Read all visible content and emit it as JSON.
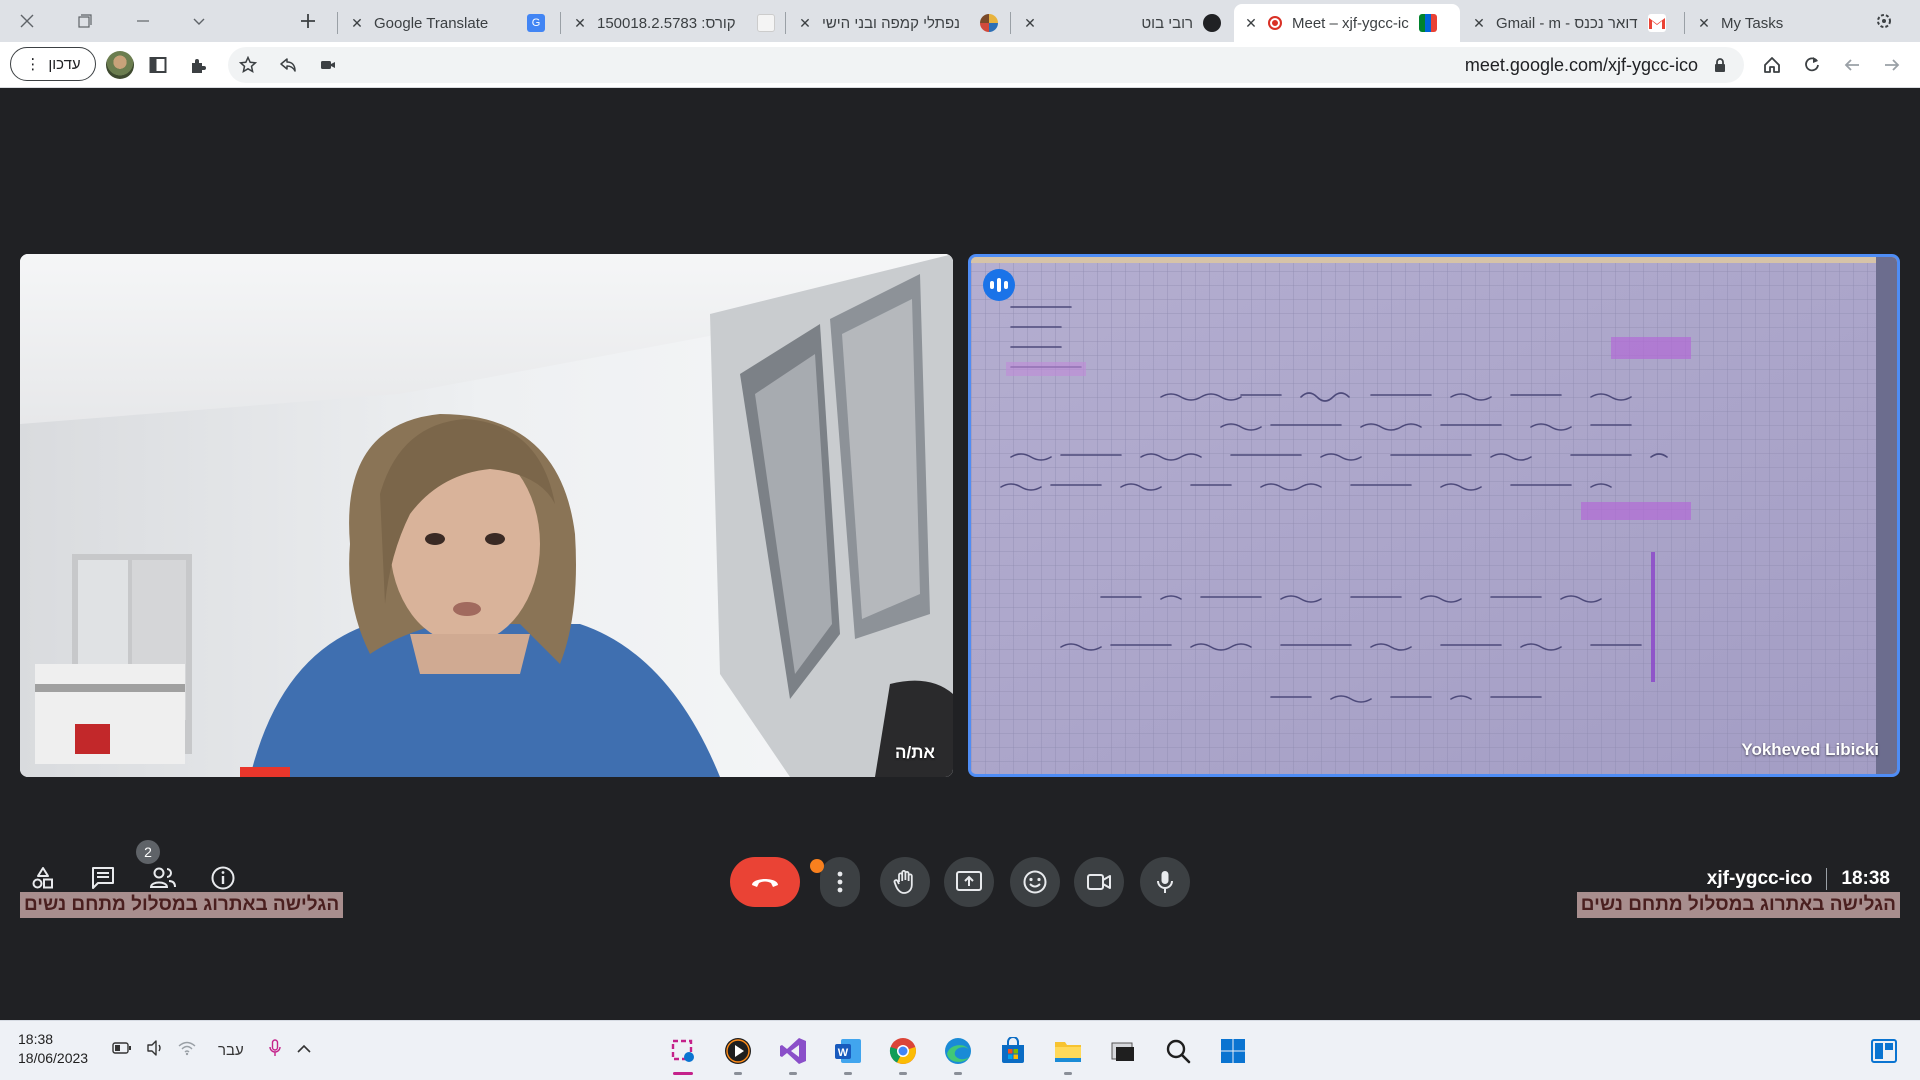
{
  "tabs": [
    {
      "title": "My Tasks",
      "favicon": "tasks-icon"
    },
    {
      "title": "דואר נכנס - Gmail - m",
      "favicon": "gmail-icon"
    },
    {
      "title": "Meet – xjf-ygcc-ic",
      "favicon": "meet-icon",
      "recording": true,
      "active": true
    },
    {
      "title": "רובי בוט",
      "favicon": "bot-icon"
    },
    {
      "title": "נפתלי קמפה ובני הישי",
      "favicon": "globe-icon"
    },
    {
      "title": "קורס: 150018.2.5783",
      "favicon": "moodle-icon"
    },
    {
      "title": "Google Translate",
      "favicon": "translate-icon"
    }
  ],
  "toolbar": {
    "url": "meet.google.com/xjf-ygcc-ico",
    "update_label": "עדכון"
  },
  "meet": {
    "self_tile_label": "את/ה",
    "remote_tile_label": "Yokheved Libicki",
    "participant_count": "2",
    "meeting_code": "xjf-ygcc-ico",
    "time": "18:38",
    "caption_text": "הגלישה באתרוג במסלול מתחם נשים",
    "end_color": "#ea4335",
    "speaking_color": "#1a73e8"
  },
  "taskbar": {
    "time": "18:38",
    "date": "18/06/2023",
    "language": "עבר"
  }
}
